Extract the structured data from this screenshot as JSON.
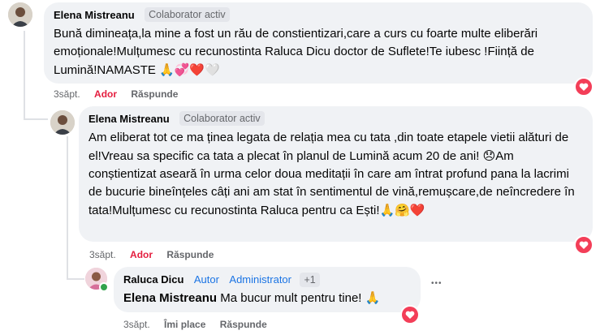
{
  "comments": [
    {
      "author": "Elena Mistreanu",
      "badge": "Colaborator activ",
      "text": "Bună dimineața,la mine a fost un rău de constientizari,care a curs cu foarte multe eliberări emoționale!Mulțumesc cu recunostinta Raluca Dicu doctor de Suflete!Te iubesc !Ființă de Lumină!NAMASTE",
      "emojis": "🙏💞❤️🤍",
      "time": "3săpt.",
      "like_label": "Ador",
      "reply_label": "Răspunde",
      "reaction": "heart"
    },
    {
      "author": "Elena Mistreanu",
      "badge": "Colaborator activ",
      "text": "Am eliberat tot ce ma ținea legata de relația mea cu tata ,din toate etapele vietii alături de el!Vreau sa specific ca tata a plecat în planul de Lumină acum 20 de ani!",
      "emoji_inline": "😞",
      "text2": "Am conștientizat aseară în urma celor doua meditații în care am întrat profund pana la lacrimi de bucurie bineînțeles câți ani am stat în sentimentul de vină,remușcare,de neîncredere în tata!Mulțumesc cu recunostinta Raluca pentru ca Ești!",
      "emojis": "🙏🤗❤️",
      "time": "3săpt.",
      "like_label": "Ador",
      "reply_label": "Răspunde",
      "reaction": "heart"
    },
    {
      "author": "Raluca Dicu",
      "role1": "Autor",
      "role2": "Administrator",
      "extra": "+1",
      "mention": "Elena Mistreanu",
      "text": "Ma bucur mult pentru tine!",
      "emojis": "🙏",
      "time": "3săpt.",
      "like_label": "Îmi place",
      "reply_label": "Răspunde",
      "reaction": "heart",
      "more_label": "•••"
    }
  ]
}
